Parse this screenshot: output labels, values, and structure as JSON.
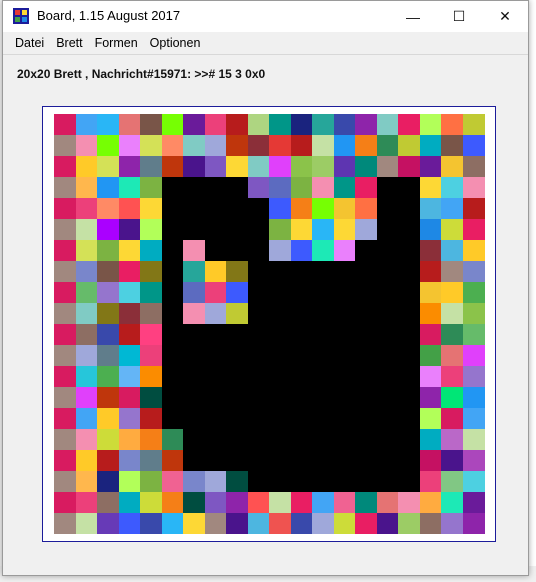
{
  "window": {
    "title": "Board, 1.15 August 2017",
    "minimize_glyph": "—",
    "maximize_glyph": "☐",
    "close_glyph": "✕"
  },
  "menu": [
    "Datei",
    "Brett",
    "Formen",
    "Optionen"
  ],
  "status": "20x20 Brett , Nachricht#15971: >># 15 3 0x0",
  "board": {
    "rows": 20,
    "cols": 20,
    "black": "#000000",
    "black_cells": [
      [
        3,
        5
      ],
      [
        3,
        6
      ],
      [
        3,
        7
      ],
      [
        3,
        8
      ],
      [
        3,
        15
      ],
      [
        3,
        16
      ],
      [
        4,
        5
      ],
      [
        4,
        6
      ],
      [
        4,
        7
      ],
      [
        4,
        8
      ],
      [
        4,
        9
      ],
      [
        4,
        15
      ],
      [
        4,
        16
      ],
      [
        5,
        5
      ],
      [
        5,
        6
      ],
      [
        5,
        7
      ],
      [
        5,
        8
      ],
      [
        5,
        9
      ],
      [
        5,
        15
      ],
      [
        5,
        16
      ],
      [
        6,
        5
      ],
      [
        6,
        7
      ],
      [
        6,
        8
      ],
      [
        6,
        9
      ],
      [
        6,
        14
      ],
      [
        6,
        15
      ],
      [
        6,
        16
      ],
      [
        7,
        5
      ],
      [
        7,
        9
      ],
      [
        7,
        10
      ],
      [
        7,
        11
      ],
      [
        7,
        12
      ],
      [
        7,
        13
      ],
      [
        7,
        14
      ],
      [
        7,
        15
      ],
      [
        7,
        16
      ],
      [
        8,
        5
      ],
      [
        8,
        9
      ],
      [
        8,
        10
      ],
      [
        8,
        11
      ],
      [
        8,
        12
      ],
      [
        8,
        13
      ],
      [
        8,
        14
      ],
      [
        8,
        15
      ],
      [
        8,
        16
      ],
      [
        9,
        5
      ],
      [
        9,
        9
      ],
      [
        9,
        10
      ],
      [
        9,
        11
      ],
      [
        9,
        12
      ],
      [
        9,
        13
      ],
      [
        9,
        14
      ],
      [
        9,
        15
      ],
      [
        9,
        16
      ],
      [
        10,
        5
      ],
      [
        10,
        6
      ],
      [
        10,
        7
      ],
      [
        10,
        8
      ],
      [
        10,
        9
      ],
      [
        10,
        10
      ],
      [
        10,
        11
      ],
      [
        10,
        12
      ],
      [
        10,
        13
      ],
      [
        10,
        14
      ],
      [
        10,
        15
      ],
      [
        10,
        16
      ],
      [
        11,
        5
      ],
      [
        11,
        6
      ],
      [
        11,
        7
      ],
      [
        11,
        8
      ],
      [
        11,
        9
      ],
      [
        11,
        10
      ],
      [
        11,
        11
      ],
      [
        11,
        12
      ],
      [
        11,
        13
      ],
      [
        11,
        14
      ],
      [
        11,
        15
      ],
      [
        11,
        16
      ],
      [
        12,
        5
      ],
      [
        12,
        6
      ],
      [
        12,
        7
      ],
      [
        12,
        8
      ],
      [
        12,
        9
      ],
      [
        12,
        10
      ],
      [
        12,
        11
      ],
      [
        12,
        12
      ],
      [
        12,
        13
      ],
      [
        12,
        14
      ],
      [
        12,
        15
      ],
      [
        12,
        16
      ],
      [
        13,
        5
      ],
      [
        13,
        6
      ],
      [
        13,
        7
      ],
      [
        13,
        8
      ],
      [
        13,
        9
      ],
      [
        13,
        10
      ],
      [
        13,
        11
      ],
      [
        13,
        12
      ],
      [
        13,
        13
      ],
      [
        13,
        14
      ],
      [
        13,
        15
      ],
      [
        13,
        16
      ],
      [
        14,
        5
      ],
      [
        14,
        6
      ],
      [
        14,
        7
      ],
      [
        14,
        8
      ],
      [
        14,
        9
      ],
      [
        14,
        10
      ],
      [
        14,
        11
      ],
      [
        14,
        12
      ],
      [
        14,
        13
      ],
      [
        14,
        14
      ],
      [
        14,
        15
      ],
      [
        14,
        16
      ],
      [
        15,
        6
      ],
      [
        15,
        7
      ],
      [
        15,
        8
      ],
      [
        15,
        9
      ],
      [
        15,
        10
      ],
      [
        15,
        11
      ],
      [
        15,
        12
      ],
      [
        15,
        13
      ],
      [
        15,
        14
      ],
      [
        15,
        15
      ],
      [
        15,
        16
      ],
      [
        16,
        6
      ],
      [
        16,
        7
      ],
      [
        16,
        8
      ],
      [
        16,
        9
      ],
      [
        16,
        10
      ],
      [
        16,
        11
      ],
      [
        16,
        12
      ],
      [
        16,
        13
      ],
      [
        16,
        14
      ],
      [
        16,
        15
      ],
      [
        16,
        16
      ],
      [
        17,
        9
      ],
      [
        17,
        10
      ],
      [
        17,
        11
      ],
      [
        17,
        12
      ],
      [
        17,
        13
      ],
      [
        17,
        14
      ],
      [
        17,
        15
      ],
      [
        17,
        16
      ]
    ],
    "palette": [
      "#d81b60",
      "#f4c430",
      "#8b2f39",
      "#4db6e0",
      "#6a1b9a",
      "#2e8b57",
      "#7e57c2",
      "#ffd54f",
      "#26a69a",
      "#ef5350",
      "#5c6bc0",
      "#9ccc65",
      "#ff7043",
      "#ab47bc",
      "#42a5f5",
      "#66bb6a",
      "#ffca28",
      "#8d6e63",
      "#ec407a",
      "#26c6da",
      "#d4e157",
      "#7cb342",
      "#3949ab",
      "#e53935",
      "#00897b",
      "#f06292",
      "#c0ca33",
      "#5e35b1",
      "#29b6f6",
      "#ff8a65",
      "#9575cd",
      "#4caf50",
      "#b71c1c",
      "#1e88e5",
      "#fdd835",
      "#00acc1",
      "#8e24aa",
      "#43a047",
      "#fb8c00",
      "#3f51b5",
      "#a1887f",
      "#81c784",
      "#e57373",
      "#64b5f6",
      "#ba68c8",
      "#4dd0e1",
      "#aed581",
      "#ff5252",
      "#7986cb",
      "#f48fb1",
      "#80cbc4",
      "#ffb74d",
      "#9fa8da",
      "#c5e1a5",
      "#e040fb",
      "#00e676",
      "#795548",
      "#607d8b",
      "#cddc39",
      "#673ab7",
      "#009688",
      "#ff4081",
      "#2196f3",
      "#8bc34a",
      "#e91e63",
      "#3d5afe",
      "#1de9b6",
      "#ffab40",
      "#c51162",
      "#00b8d4",
      "#76ff03",
      "#aa00ff",
      "#827717",
      "#bf360c",
      "#1a237e",
      "#004d40",
      "#f57f17",
      "#4a148c",
      "#b2ff59",
      "#ea80fc"
    ]
  }
}
